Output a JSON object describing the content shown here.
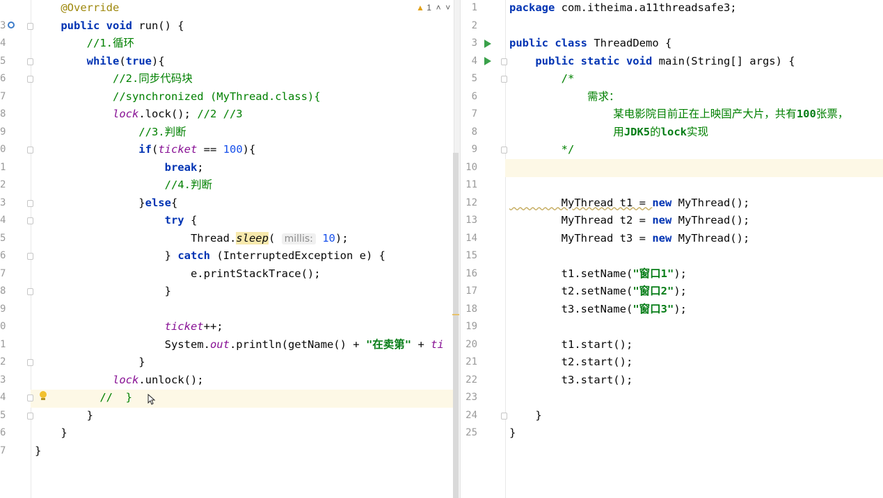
{
  "left_editor": {
    "warning_count": "1",
    "line_numbers": [
      "",
      "3",
      "4",
      "5",
      "6",
      "7",
      "8",
      "9",
      "0",
      "1",
      "2",
      "3",
      "4",
      "5",
      "6",
      "7",
      "8",
      "9",
      "0",
      "1",
      "2",
      "3",
      "4",
      "5",
      "6",
      "7"
    ],
    "hint_label": "millis:",
    "lines": [
      {
        "tokens": [
          {
            "t": "    @Override",
            "c": "an"
          }
        ]
      },
      {
        "tokens": [
          {
            "t": "    public void ",
            "c": "kw"
          },
          {
            "t": "run() {"
          }
        ]
      },
      {
        "tokens": [
          {
            "t": "        //1.循环",
            "c": "cm"
          }
        ]
      },
      {
        "tokens": [
          {
            "t": "        while",
            "c": "kw"
          },
          {
            "t": "("
          },
          {
            "t": "true",
            "c": "kw"
          },
          {
            "t": "){"
          }
        ]
      },
      {
        "tokens": [
          {
            "t": "            //2.同步代码块",
            "c": "cm"
          }
        ]
      },
      {
        "tokens": [
          {
            "t": "            //synchronized (MyThread.class){",
            "c": "cm"
          }
        ]
      },
      {
        "tokens": [
          {
            "t": "            "
          },
          {
            "t": "lock",
            "c": "fld"
          },
          {
            "t": ".lock(); "
          },
          {
            "t": "//2 //3",
            "c": "cm"
          }
        ]
      },
      {
        "tokens": [
          {
            "t": "                //3.判断",
            "c": "cm"
          }
        ]
      },
      {
        "tokens": [
          {
            "t": "                if",
            "c": "kw"
          },
          {
            "t": "("
          },
          {
            "t": "ticket",
            "c": "fld"
          },
          {
            "t": " == "
          },
          {
            "t": "100",
            "c": "num"
          },
          {
            "t": "){"
          }
        ]
      },
      {
        "tokens": [
          {
            "t": "                    break",
            "c": "kw"
          },
          {
            "t": ";"
          }
        ]
      },
      {
        "tokens": [
          {
            "t": "                    //4.判断",
            "c": "cm"
          }
        ]
      },
      {
        "tokens": [
          {
            "t": "                }"
          },
          {
            "t": "else",
            "c": "kw"
          },
          {
            "t": "{"
          }
        ]
      },
      {
        "tokens": [
          {
            "t": "                    try",
            "c": "kw"
          },
          {
            "t": " {"
          }
        ]
      },
      {
        "tokens": [
          {
            "t": "                        Thread."
          },
          {
            "t": "sleep",
            "c": "sleep-hl"
          },
          {
            "t": "( "
          },
          {
            "t": "HINT",
            "c": "hint"
          },
          {
            "t": " "
          },
          {
            "t": "10",
            "c": "num"
          },
          {
            "t": ");"
          }
        ]
      },
      {
        "tokens": [
          {
            "t": "                    } "
          },
          {
            "t": "catch",
            "c": "kw"
          },
          {
            "t": " (InterruptedException e) {"
          }
        ]
      },
      {
        "tokens": [
          {
            "t": "                        e.printStackTrace();"
          }
        ]
      },
      {
        "tokens": [
          {
            "t": "                    }"
          }
        ]
      },
      {
        "tokens": [
          {
            "t": ""
          }
        ]
      },
      {
        "tokens": [
          {
            "t": "                    "
          },
          {
            "t": "ticket",
            "c": "fld"
          },
          {
            "t": "++;"
          }
        ]
      },
      {
        "tokens": [
          {
            "t": "                    System."
          },
          {
            "t": "out",
            "c": "fld"
          },
          {
            "t": ".println(getName() + "
          },
          {
            "t": "\"在卖第\"",
            "c": "str"
          },
          {
            "t": " + "
          },
          {
            "t": "ti",
            "c": "fld"
          }
        ]
      },
      {
        "tokens": [
          {
            "t": "                }"
          }
        ]
      },
      {
        "tokens": [
          {
            "t": "            "
          },
          {
            "t": "lock",
            "c": "fld"
          },
          {
            "t": ".unlock();"
          }
        ]
      },
      {
        "tokens": [
          {
            "t": "          //  }",
            "c": "cm"
          }
        ]
      },
      {
        "tokens": [
          {
            "t": "        }"
          }
        ]
      },
      {
        "tokens": [
          {
            "t": "    }"
          }
        ]
      },
      {
        "tokens": [
          {
            "t": "}"
          }
        ]
      }
    ]
  },
  "right_editor": {
    "line_numbers": [
      "1",
      "2",
      "3",
      "4",
      "5",
      "6",
      "7",
      "8",
      "9",
      "10",
      "11",
      "12",
      "13",
      "14",
      "15",
      "16",
      "17",
      "18",
      "19",
      "20",
      "21",
      "22",
      "23",
      "24",
      "25"
    ],
    "lines": [
      {
        "tokens": [
          {
            "t": "package",
            "c": "kw"
          },
          {
            "t": " com.itheima.a11threadsafe3;"
          }
        ]
      },
      {
        "tokens": [
          {
            "t": ""
          }
        ]
      },
      {
        "tokens": [
          {
            "t": "public class ",
            "c": "kw"
          },
          {
            "t": "ThreadDemo {"
          }
        ]
      },
      {
        "tokens": [
          {
            "t": "    public static void ",
            "c": "kw"
          },
          {
            "t": "main(String[] args) {"
          }
        ]
      },
      {
        "tokens": [
          {
            "t": "        /*",
            "c": "cm"
          }
        ]
      },
      {
        "tokens": [
          {
            "t": "            需求：",
            "c": "cm"
          }
        ]
      },
      {
        "tokens": [
          {
            "t": "                某电影院目前正在上映国产大片，共有",
            "c": "cm"
          },
          {
            "t": "100",
            "c": "str"
          },
          {
            "t": "张票，",
            "c": "cm"
          }
        ]
      },
      {
        "tokens": [
          {
            "t": "                用",
            "c": "cm"
          },
          {
            "t": "JDK5",
            "c": "str"
          },
          {
            "t": "的",
            "c": "cm"
          },
          {
            "t": "lock",
            "c": "str"
          },
          {
            "t": "实现",
            "c": "cm"
          }
        ]
      },
      {
        "tokens": [
          {
            "t": "        */",
            "c": "cm"
          }
        ]
      },
      {
        "tokens": [
          {
            "t": ""
          }
        ]
      },
      {
        "tokens": [
          {
            "t": ""
          }
        ]
      },
      {
        "tokens": [
          {
            "t": "        MyThread t1 = ",
            "c": "squiggle"
          },
          {
            "t": "new",
            "c": "kw"
          },
          {
            "t": " MyThread();"
          }
        ]
      },
      {
        "tokens": [
          {
            "t": "        MyThread t2 = "
          },
          {
            "t": "new",
            "c": "kw"
          },
          {
            "t": " MyThread();"
          }
        ]
      },
      {
        "tokens": [
          {
            "t": "        MyThread t3 = "
          },
          {
            "t": "new",
            "c": "kw"
          },
          {
            "t": " MyThread();"
          }
        ]
      },
      {
        "tokens": [
          {
            "t": ""
          }
        ]
      },
      {
        "tokens": [
          {
            "t": "        t1.setName("
          },
          {
            "t": "\"窗口1\"",
            "c": "str"
          },
          {
            "t": ");"
          }
        ]
      },
      {
        "tokens": [
          {
            "t": "        t2.setName("
          },
          {
            "t": "\"窗口2\"",
            "c": "str"
          },
          {
            "t": ");"
          }
        ]
      },
      {
        "tokens": [
          {
            "t": "        t3.setName("
          },
          {
            "t": "\"窗口3\"",
            "c": "str"
          },
          {
            "t": ");"
          }
        ]
      },
      {
        "tokens": [
          {
            "t": ""
          }
        ]
      },
      {
        "tokens": [
          {
            "t": "        t1.start();"
          }
        ]
      },
      {
        "tokens": [
          {
            "t": "        t2.start();"
          }
        ]
      },
      {
        "tokens": [
          {
            "t": "        t3.start();"
          }
        ]
      },
      {
        "tokens": [
          {
            "t": ""
          }
        ]
      },
      {
        "tokens": [
          {
            "t": "    }"
          }
        ]
      },
      {
        "tokens": [
          {
            "t": "}"
          }
        ]
      }
    ]
  },
  "colors": {
    "keyword": "#0033b3",
    "comment": "#008000",
    "string": "#067d17",
    "number": "#1750eb",
    "field": "#871094",
    "annotation": "#9e880d",
    "run_icon": "#3aa14a"
  }
}
